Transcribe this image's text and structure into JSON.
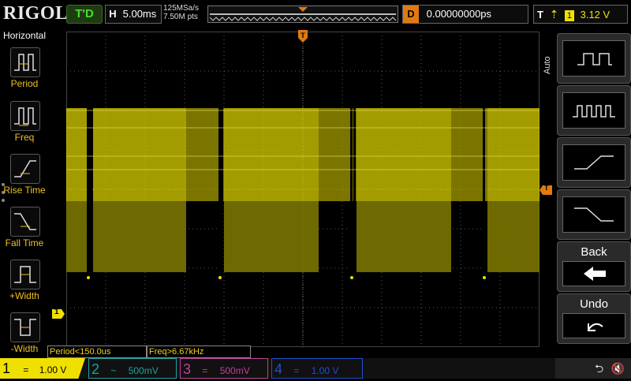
{
  "header": {
    "logo": "RIGOL",
    "run_status": "T'D",
    "horizontal_label": "H",
    "timebase": "5.00ms",
    "sample_rate": "125MSa/s",
    "memory_depth": "7.50M pts",
    "delay_label": "D",
    "delay_value": "0.00000000ps",
    "trigger_label": "T",
    "trigger_source": "1",
    "trigger_level": "3.12 V"
  },
  "left_menu": {
    "title": "Horizontal",
    "items": [
      {
        "label": "Period",
        "icon": "period-icon"
      },
      {
        "label": "Freq",
        "icon": "frequency-icon"
      },
      {
        "label": "Rise Time",
        "icon": "rise-time-icon"
      },
      {
        "label": "Fall Time",
        "icon": "fall-time-icon"
      },
      {
        "label": "+Width",
        "icon": "positive-width-icon"
      },
      {
        "label": "-Width",
        "icon": "negative-width-icon"
      }
    ]
  },
  "right_menu": {
    "auto_label": "Auto",
    "buttons": [
      {
        "name": "pulse-single-icon"
      },
      {
        "name": "pulse-train-icon"
      },
      {
        "name": "rising-edge-icon"
      },
      {
        "name": "falling-edge-icon"
      },
      {
        "label": "Back",
        "icon": "back-arrow-icon"
      },
      {
        "label": "Undo",
        "icon": "undo-icon"
      }
    ]
  },
  "measurements": {
    "period": "Period<150.0us",
    "freq": "Freq>6.67kHz"
  },
  "channels": [
    {
      "num": "1",
      "coupling": "=",
      "scale": "1.00 V",
      "color": "#f0e000",
      "active": true
    },
    {
      "num": "2",
      "coupling": "~",
      "scale": "500mV",
      "color": "#1aa3a3",
      "active": false
    },
    {
      "num": "3",
      "coupling": "=",
      "scale": "500mV",
      "color": "#c0409a",
      "active": false
    },
    {
      "num": "4",
      "coupling": "=",
      "scale": "1.00 V",
      "color": "#2050d0",
      "active": false
    }
  ],
  "markers": {
    "trigger_level_marker": "T",
    "ch1_ground_marker": "1"
  },
  "colors": {
    "trace": "#d8d000",
    "grid": "#5a5a5a",
    "accent": "#e07a10"
  }
}
